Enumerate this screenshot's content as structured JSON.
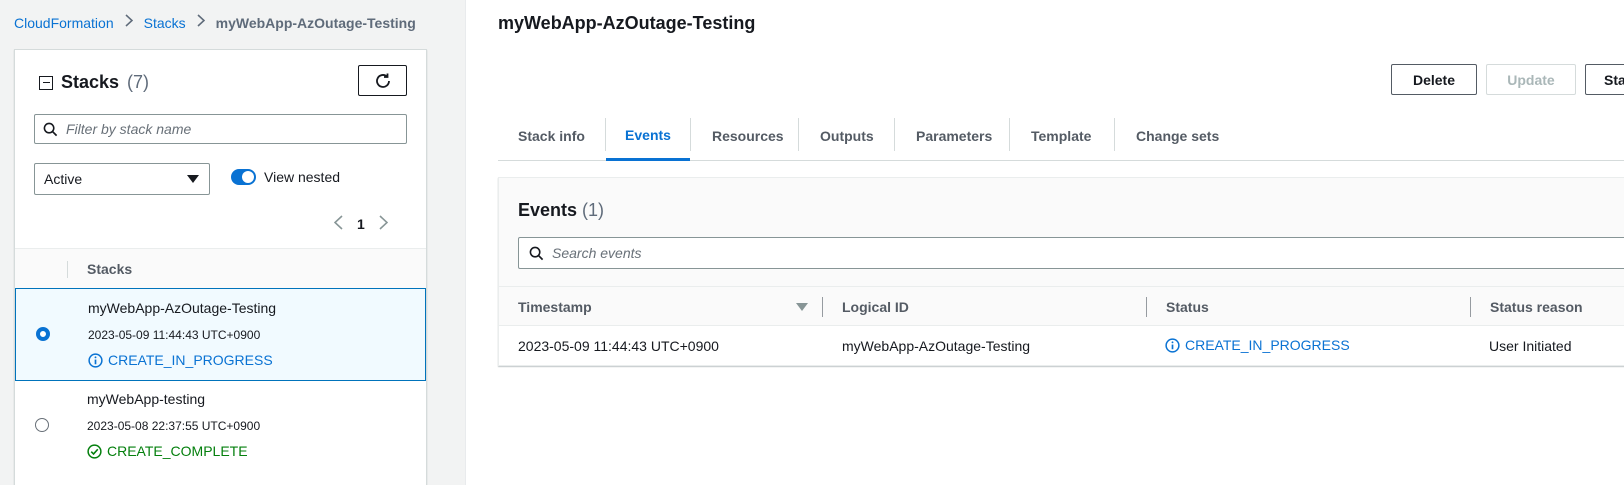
{
  "breadcrumb": {
    "items": [
      "CloudFormation",
      "Stacks"
    ],
    "current": "myWebApp-AzOutage-Testing"
  },
  "stacks_panel": {
    "title": "Stacks",
    "count": "(7)",
    "filter_placeholder": "Filter by stack name",
    "status_filter": "Active",
    "view_nested_label": "View nested",
    "view_nested_enabled": true,
    "page": "1",
    "column_header": "Stacks",
    "rows": [
      {
        "name": "myWebApp-AzOutage-Testing",
        "timestamp": "2023-05-09 11:44:43 UTC+0900",
        "status": "CREATE_IN_PROGRESS",
        "status_icon": "info-icon",
        "selected": true
      },
      {
        "name": "myWebApp-testing",
        "timestamp": "2023-05-08 22:37:55 UTC+0900",
        "status": "CREATE_COMPLETE",
        "status_icon": "check-circle-icon",
        "selected": false
      }
    ]
  },
  "main": {
    "title": "myWebApp-AzOutage-Testing",
    "buttons": {
      "delete": "Delete",
      "update": "Update",
      "start": "Sta"
    },
    "tabs": [
      "Stack info",
      "Events",
      "Resources",
      "Outputs",
      "Parameters",
      "Template",
      "Change sets"
    ],
    "active_tab": "Events",
    "events": {
      "title": "Events",
      "count": "(1)",
      "search_placeholder": "Search events",
      "columns": [
        "Timestamp",
        "Logical ID",
        "Status",
        "Status reason"
      ],
      "rows": [
        {
          "timestamp": "2023-05-09 11:44:43 UTC+0900",
          "logical_id": "myWebApp-AzOutage-Testing",
          "status": "CREATE_IN_PROGRESS",
          "status_reason": "User Initiated"
        }
      ]
    }
  },
  "colors": {
    "link_blue": "#0972d3",
    "success_green": "#037f0c",
    "text_dark": "#16191f",
    "text_muted": "#545b64"
  }
}
